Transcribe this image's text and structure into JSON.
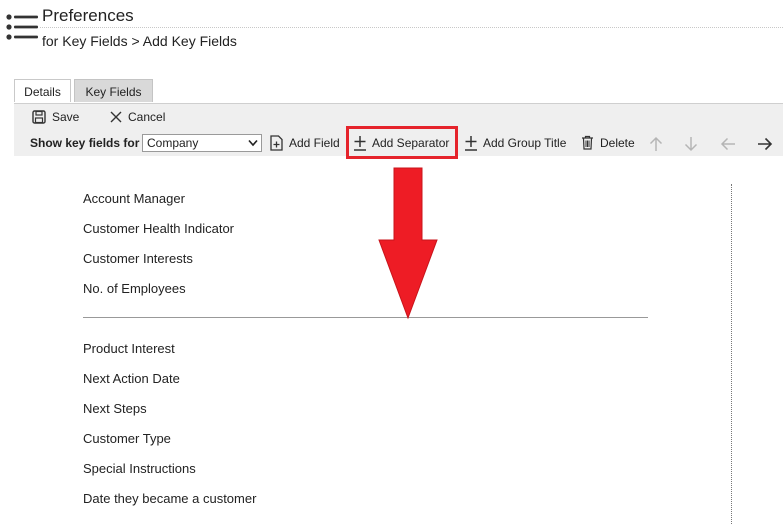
{
  "header": {
    "title": "Preferences",
    "subtitle": "for Key Fields > Add Key Fields",
    "menu_icon": "list-icon"
  },
  "tabs": [
    {
      "label": "Details",
      "active": false
    },
    {
      "label": "Key Fields",
      "active": true
    }
  ],
  "toolbar": {
    "save_label": "Save",
    "cancel_label": "Cancel",
    "show_key_fields_label": "Show key fields for",
    "entity_select_value": "Company",
    "add_field_label": "Add Field",
    "add_separator_label": "Add Separator",
    "add_group_title_label": "Add Group Title",
    "delete_label": "Delete",
    "icons": [
      "save-icon",
      "close-icon",
      "add-document-icon",
      "plus-icon",
      "plus-icon",
      "trash-icon",
      "arrow-up-icon",
      "arrow-down-icon",
      "arrow-left-icon",
      "arrow-right-icon"
    ]
  },
  "annotation": {
    "highlight_color": "#e5232b",
    "arrow_color": "#ee1c25"
  },
  "fields_before_separator": [
    "Account Manager",
    "Customer Health Indicator",
    "Customer Interests",
    "No. of Employees"
  ],
  "fields_after_separator": [
    "Product Interest",
    "Next Action Date",
    "Next Steps",
    "Customer Type",
    "Special Instructions",
    "Date they became a customer"
  ]
}
